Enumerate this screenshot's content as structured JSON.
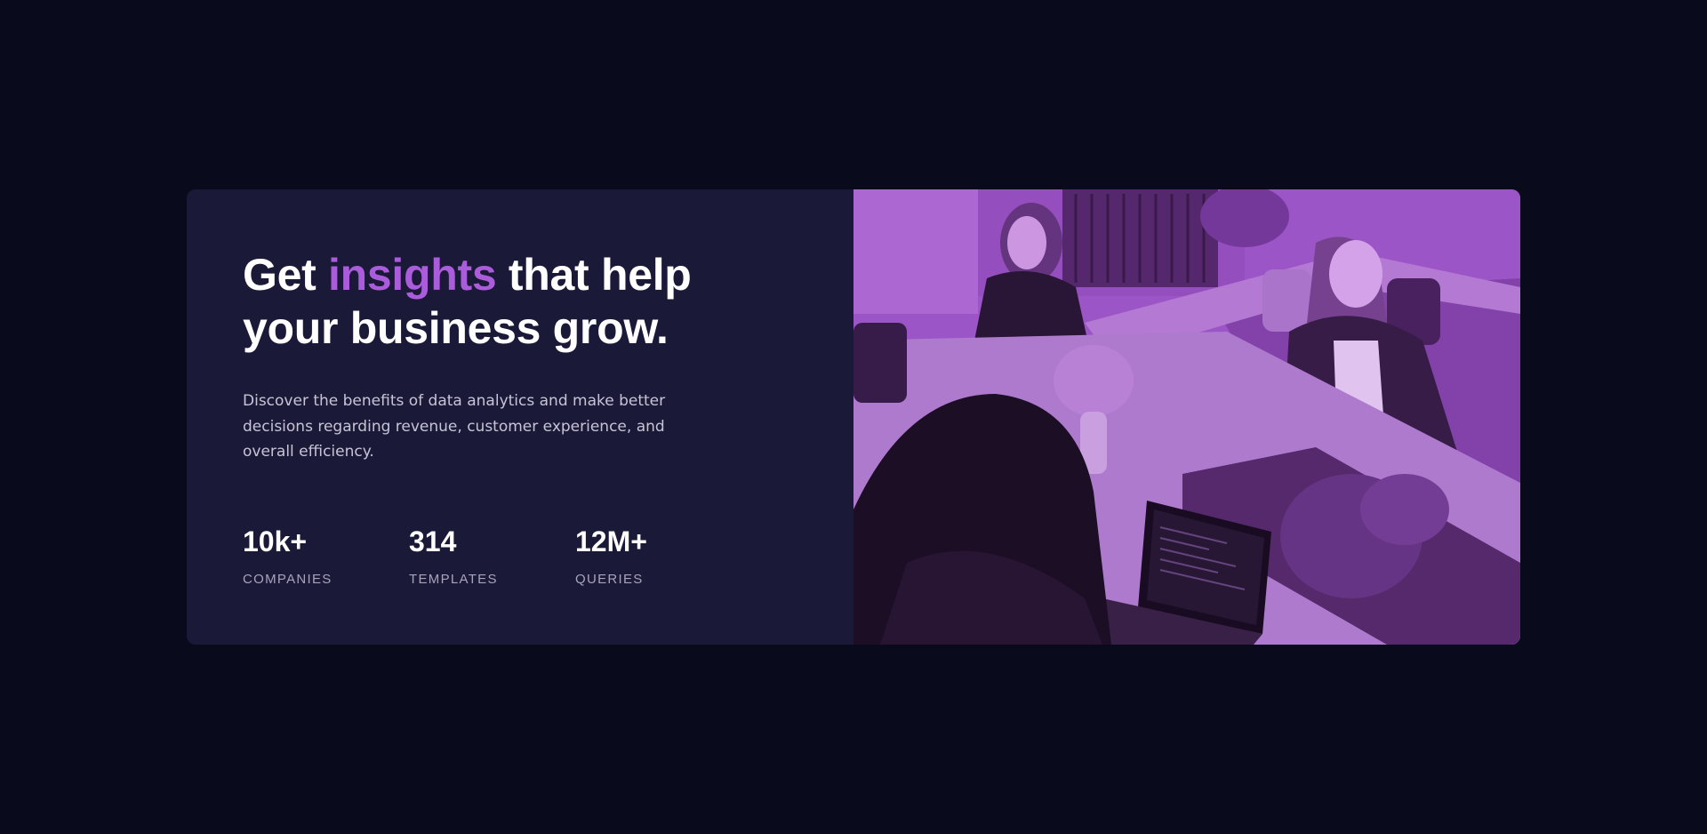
{
  "hero": {
    "headline_before": "Get ",
    "headline_accent": "insights",
    "headline_after": " that help your business grow.",
    "description": "Discover the benefits of data analytics and make better decisions regarding revenue, customer experience, and overall efficiency."
  },
  "stats": [
    {
      "value": "10k+",
      "label": "COMPANIES"
    },
    {
      "value": "314",
      "label": "TEMPLATES"
    },
    {
      "value": "12M+",
      "label": "QUERIES"
    }
  ],
  "colors": {
    "page_background": "#090b1c",
    "card_background": "#1b1938",
    "accent": "#aa5cdb",
    "photo_tint": "#a660cc"
  },
  "image": {
    "subject": "three-women-working-at-office-table-photo"
  }
}
